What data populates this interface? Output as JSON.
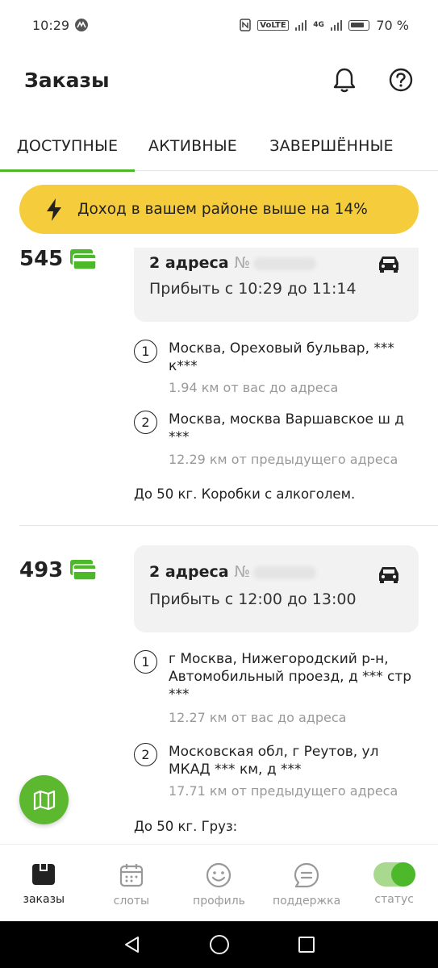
{
  "status_bar": {
    "time": "10:29",
    "net_badge": "VoLTE",
    "network": "4G",
    "battery": "70 %"
  },
  "header": {
    "title": "Заказы"
  },
  "tabs": [
    {
      "label": "ДОСТУПНЫЕ",
      "active": true
    },
    {
      "label": "АКТИВНЫЕ",
      "active": false
    },
    {
      "label": "ЗАВЕРШЁННЫЕ",
      "active": false
    }
  ],
  "banner": {
    "text": "Доход в вашем районе выше на 14%"
  },
  "orders": [
    {
      "price": "545",
      "title": "2 адреса",
      "number_prefix": "№",
      "time": "Прибыть с 10:29 до 11:14",
      "addresses": [
        {
          "num": "1",
          "text": "Москва, Ореховый бульвар, *** к***",
          "distance": "1.94 км от вас до адреса"
        },
        {
          "num": "2",
          "text": "Москва, москва Варшавское ш д ***",
          "distance": "12.29 км от предыдущего адреса"
        }
      ],
      "note": "До 50 кг. Коробки с алкоголем."
    },
    {
      "price": "493",
      "title": "2 адреса",
      "number_prefix": "№",
      "time": "Прибыть с 12:00 до 13:00",
      "addresses": [
        {
          "num": "1",
          "text": "г Москва, Нижегородский р-н, Автомобильный проезд, д *** стр ***",
          "distance": "12.27 км от вас до адреса"
        },
        {
          "num": "2",
          "text": "Московская обл, г Реутов, ул МКАД *** км, д ***",
          "distance": "17.71 км от предыдущего адреса"
        }
      ],
      "note": "До 50 кг. Груз:"
    }
  ],
  "bottom_nav": [
    {
      "label": "заказы",
      "icon": "orders-box-icon",
      "active": true
    },
    {
      "label": "слоты",
      "icon": "calendar-icon",
      "active": false
    },
    {
      "label": "профиль",
      "icon": "smiley-icon",
      "active": false
    },
    {
      "label": "поддержка",
      "icon": "chat-icon",
      "active": false
    },
    {
      "label": "статус",
      "icon": "toggle-icon",
      "active": false
    }
  ],
  "colors": {
    "accent_green": "#4cb82a",
    "banner_yellow": "#f5cc3b",
    "card_bg": "#f2f2f2"
  }
}
